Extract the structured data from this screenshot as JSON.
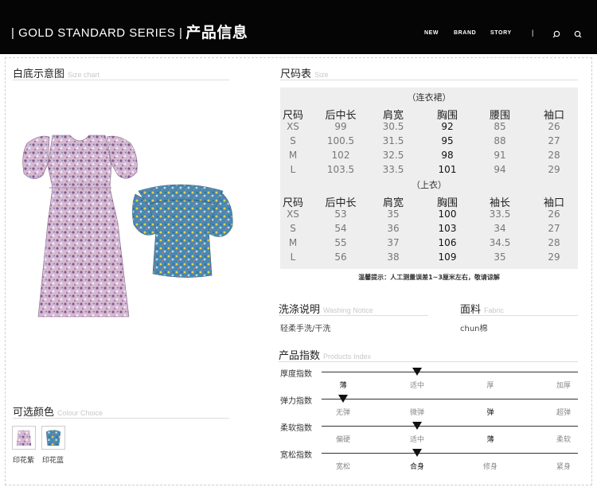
{
  "header": {
    "series": "| GOLD STANDARD SERIES |",
    "title_zh": "产品信息",
    "nav": [
      "NEW",
      "BRAND",
      "STORY"
    ],
    "icons": [
      "search-icon",
      "search-icon"
    ]
  },
  "left": {
    "picture_title": "白底示意图",
    "picture_title_en": "Size chart",
    "colour_title": "可选颜色",
    "colour_title_en": "Colour Choice",
    "colours": [
      {
        "name": "印花紫",
        "hex": "#c9a4c8"
      },
      {
        "name": "印花蓝",
        "hex": "#4e8eb5"
      }
    ]
  },
  "size_table": {
    "title": "尺码表",
    "title_en": "Size",
    "groups": [
      {
        "name": "（连衣裙）",
        "headers": [
          "尺码",
          "后中长",
          "肩宽",
          "胸围",
          "腰围",
          "袖口"
        ],
        "rows": [
          [
            "XS",
            "99",
            "30.5",
            "92",
            "85",
            "26"
          ],
          [
            "S",
            "100.5",
            "31.5",
            "95",
            "88",
            "27"
          ],
          [
            "M",
            "102",
            "32.5",
            "98",
            "91",
            "28"
          ],
          [
            "L",
            "103.5",
            "33.5",
            "101",
            "94",
            "29"
          ]
        ]
      },
      {
        "name": "（上衣）",
        "headers": [
          "尺码",
          "后中长",
          "肩宽",
          "胸围",
          "袖长",
          "袖口"
        ],
        "rows": [
          [
            "XS",
            "53",
            "35",
            "100",
            "33.5",
            "26"
          ],
          [
            "S",
            "54",
            "36",
            "103",
            "34",
            "27"
          ],
          [
            "M",
            "55",
            "37",
            "106",
            "34.5",
            "28"
          ],
          [
            "L",
            "56",
            "38",
            "109",
            "35",
            "29"
          ]
        ]
      }
    ],
    "note": "温馨提示：人工测量误差1~3厘米左右，敬请谅解"
  },
  "washing": {
    "title": "洗涤说明",
    "title_en": "Washing Notice",
    "text": "轻柔手洗/干洗"
  },
  "fabric": {
    "title": "面料",
    "title_en": "Fabric",
    "text": "chun棉"
  },
  "product_index": {
    "title": "产品指数",
    "title_en": "Products Index",
    "items": [
      {
        "label": "厚度指数",
        "options": [
          "薄",
          "适中",
          "厚",
          "加厚"
        ],
        "selected": 0,
        "marker_pos": 1
      },
      {
        "label": "弹力指数",
        "options": [
          "无弹",
          "微弹",
          "弹",
          "超弹"
        ],
        "selected": 2,
        "marker_pos": 0
      },
      {
        "label": "柔软指数",
        "options": [
          "偏硬",
          "适中",
          "薄",
          "柔软"
        ],
        "selected": 2,
        "marker_pos": 1
      },
      {
        "label": "宽松指数",
        "options": [
          "宽松",
          "合身",
          "修身",
          "紧身"
        ],
        "selected": 1,
        "marker_pos": 1
      }
    ]
  }
}
